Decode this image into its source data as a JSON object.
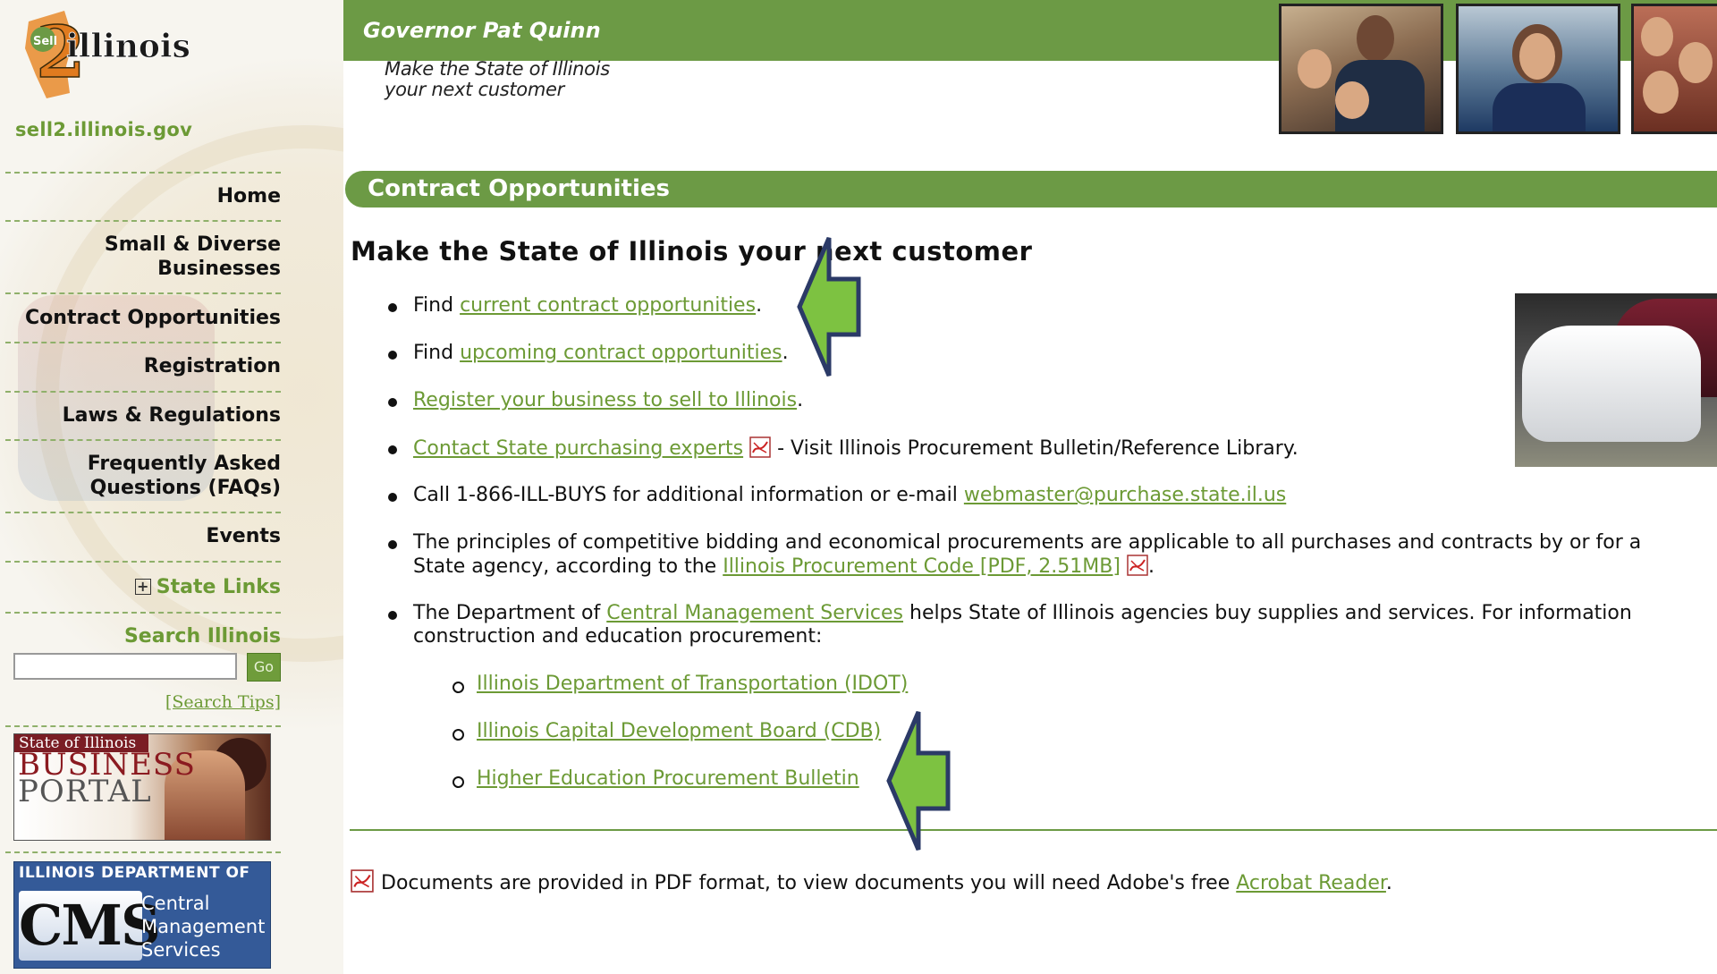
{
  "site": {
    "logo_text": "Sell 2 Illinois",
    "url": "sell2.illinois.gov",
    "governor": "Governor Pat Quinn",
    "tagline_line1": "Make the State of Illinois",
    "tagline_line2": "your next customer"
  },
  "nav": {
    "items": [
      {
        "label": "Home"
      },
      {
        "label": "Small & Diverse",
        "label2": "Businesses"
      },
      {
        "label": "Contract Opportunities"
      },
      {
        "label": "Registration"
      },
      {
        "label": "Laws & Regulations"
      },
      {
        "label": "Frequently Asked",
        "label2": "Questions (FAQs)"
      },
      {
        "label": "Events"
      }
    ],
    "state_links": "State Links",
    "search_title": "Search Illinois",
    "search_value": "",
    "go_label": "Go",
    "search_tips": "[Search Tips]"
  },
  "banners": {
    "portal_line1": "State of Illinois",
    "portal_line2": "BUSINESS",
    "portal_line3": "PORTAL",
    "cms_top": "ILLINOIS DEPARTMENT OF",
    "cms_logo": "CMS",
    "cms_word1": "Central",
    "cms_word2": "Management",
    "cms_word3": "Services"
  },
  "main": {
    "section_title": "Contract Opportunities",
    "heading": "Make the State of Illinois your next customer",
    "items": {
      "i1_pre": "Find ",
      "i1_link": "current contract opportunities",
      "i1_post": ".",
      "i2_pre": "Find ",
      "i2_link": "upcoming contract opportunities",
      "i2_post": ".",
      "i3_link": "Register your business to sell to Illinois",
      "i3_post": ".",
      "i4_link": "Contact State purchasing experts",
      "i4_post": " - Visit Illinois Procurement Bulletin/Reference Library.",
      "i5_pre": "Call 1-866-ILL-BUYS for additional information or e-mail ",
      "i5_link": "webmaster@purchase.state.il.us",
      "i6_line1": "The principles of competitive bidding and economical procurements are applicable to all purchases and contracts by or for a",
      "i6_pre": "State agency, according to the ",
      "i6_link": "Illinois Procurement Code [PDF, 2.51MB]",
      "i6_post": ".",
      "i7_pre": "The Department of ",
      "i7_link": "Central Management Services",
      "i7_post": " helps State of Illinois agencies buy supplies and services. For information",
      "i7_line2": "construction and education procurement:"
    },
    "subitems": [
      "Illinois Department of Transportation (IDOT)",
      "Illinois Capital Development Board (CDB)",
      "Higher Education Procurement Bulletin"
    ],
    "footnote_pre": "Documents are provided in PDF format, to view documents you will need Adobe's free ",
    "footnote_link": "Acrobat Reader",
    "footnote_post": "."
  },
  "icons": {
    "pdf": "pdf-icon",
    "expand": "plus-box-icon",
    "annotation": "green-arrow-pointer"
  },
  "colors": {
    "brand_green": "#6c9a45",
    "link_green": "#6c9a35",
    "arrow_green": "#7dc241",
    "arrow_outline": "#2b3a67"
  }
}
